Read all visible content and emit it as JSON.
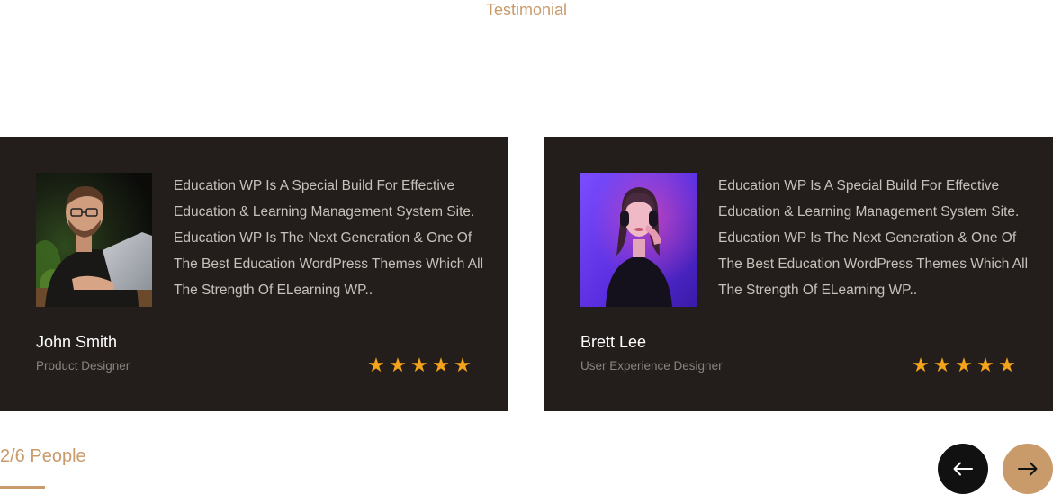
{
  "section": {
    "eyebrow": "Testimonial"
  },
  "testimonials": [
    {
      "quote": "Education WP Is A Special Build For Effective Education & Learning Management System Site. Education WP Is The Next Generation & One Of The Best Education WordPress Themes Which All The Strength Of ELearning WP..",
      "name": "John Smith",
      "role": "Product Designer",
      "rating": 5,
      "stars": [
        "★",
        "★",
        "★",
        "★",
        "★"
      ],
      "photo": "man-with-laptop-photo"
    },
    {
      "quote": "Education WP Is A Special Build For Effective Education & Learning Management System Site. Education WP Is The Next Generation & One Of The Best Education WordPress Themes Which All The Strength Of ELearning WP..",
      "name": "Brett Lee",
      "role": "User Experience Designer",
      "rating": 5,
      "stars": [
        "★",
        "★",
        "★",
        "★",
        "★"
      ],
      "photo": "woman-with-headphones-photo"
    }
  ],
  "pagination": {
    "counter": "2/6 People"
  },
  "nav": {
    "prev_icon": "arrow-left-icon",
    "next_icon": "arrow-right-icon"
  },
  "colors": {
    "accent": "#c99a6a",
    "card_bg": "#231e1b",
    "star": "#f5a31a",
    "prev_button": "#111111"
  }
}
